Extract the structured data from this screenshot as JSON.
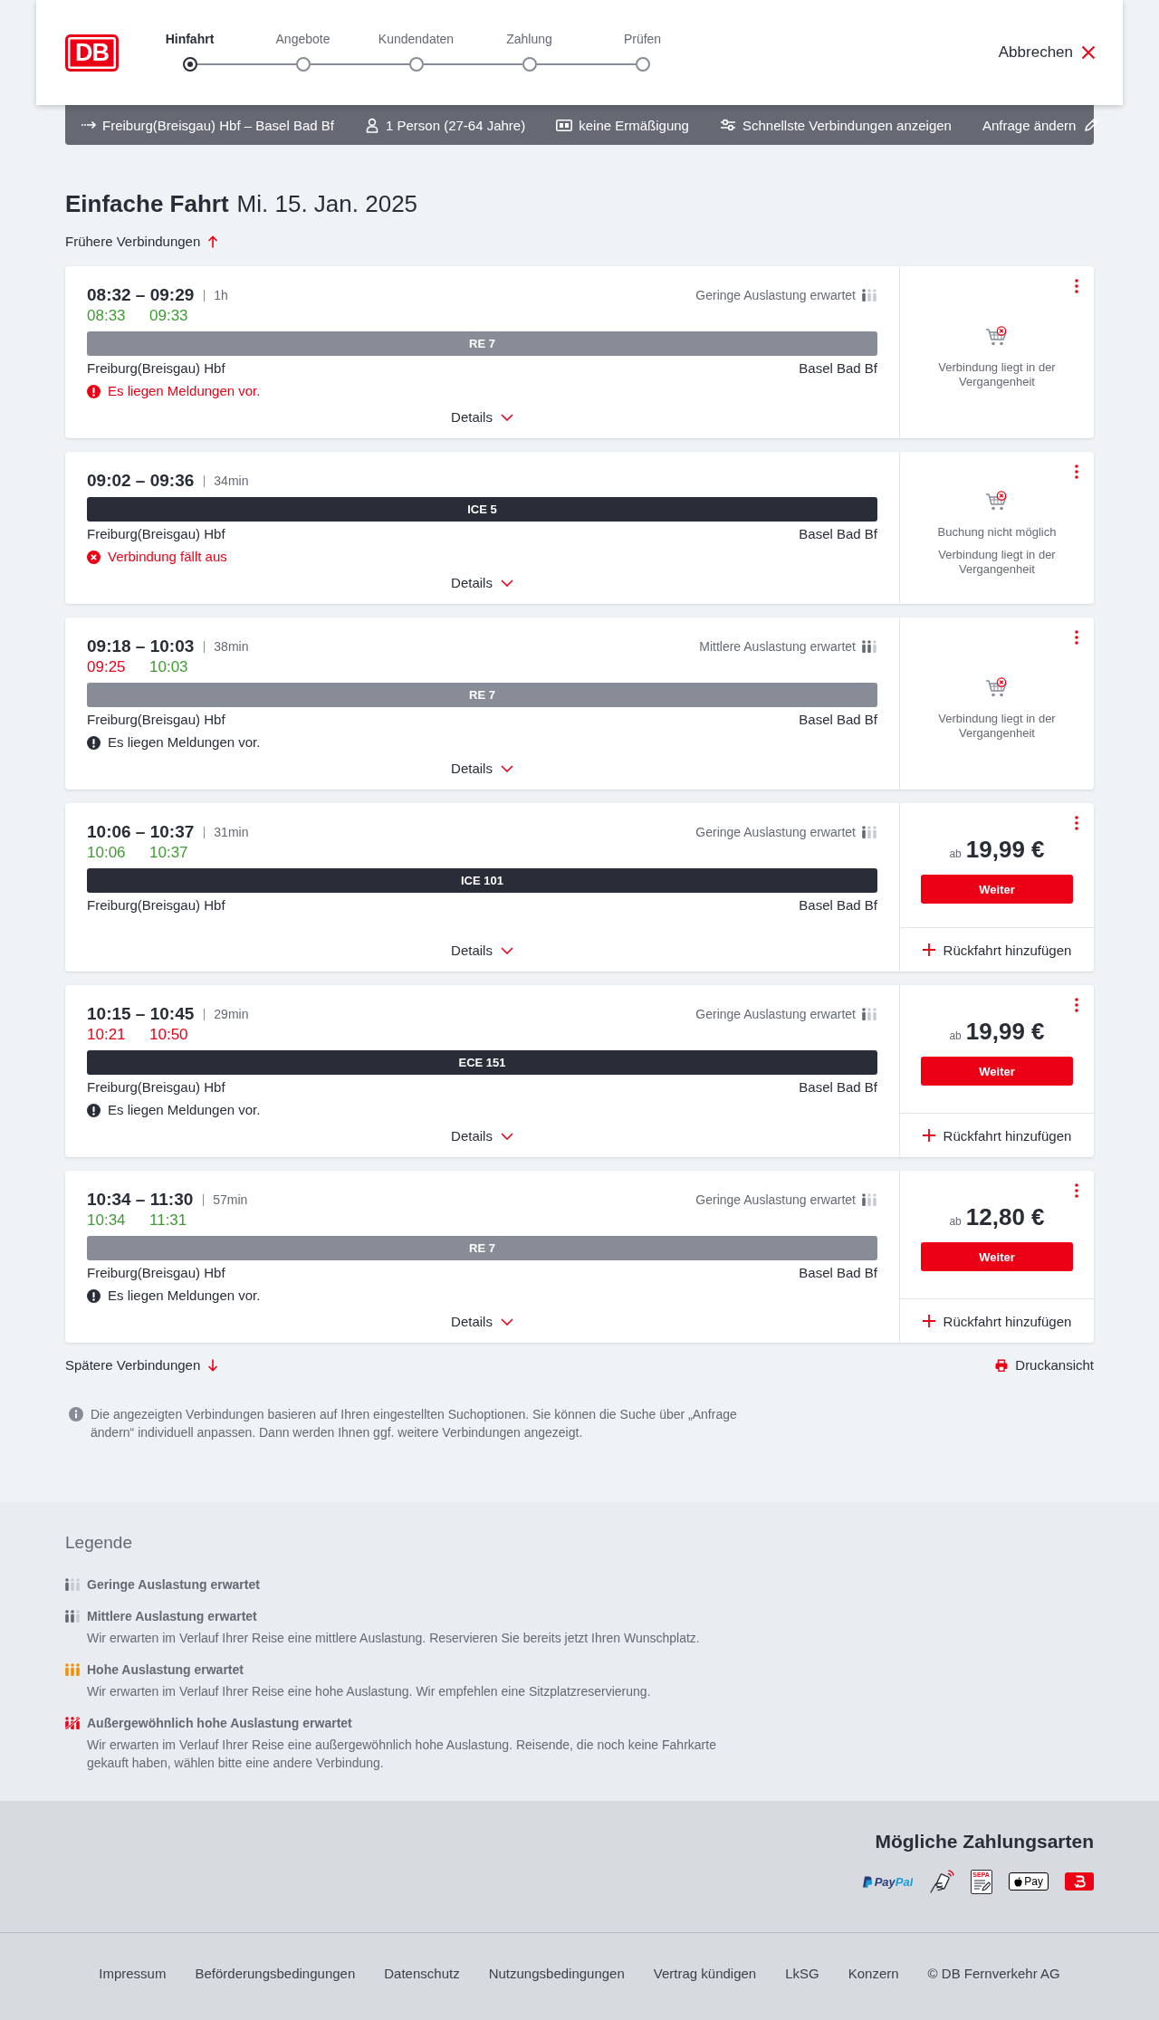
{
  "header": {
    "logo": "DB",
    "steps": [
      {
        "label": "Hinfahrt",
        "selected": true
      },
      {
        "label": "Angebote",
        "selected": false
      },
      {
        "label": "Kundendaten",
        "selected": false
      },
      {
        "label": "Zahlung",
        "selected": false
      },
      {
        "label": "Prüfen",
        "selected": false
      }
    ],
    "cancel": "Abbrechen"
  },
  "search_summary": {
    "route": "Freiburg(Breisgau) Hbf – Basel Bad Bf",
    "passengers": "1 Person (27-64 Jahre)",
    "discount": "keine Ermäßigung",
    "option": "Schnellste Verbindungen anzeigen",
    "edit": "Anfrage ändern"
  },
  "heading": {
    "trip_type": "Einfache Fahrt",
    "date": "Mi. 15. Jan. 2025"
  },
  "earlier": "Frühere Verbindungen",
  "connections": [
    {
      "times": "08:32 – 09:29",
      "duration": "1h",
      "realtime": [
        {
          "time": "08:33",
          "delayed": false
        },
        {
          "time": "09:33",
          "delayed": false
        }
      ],
      "occupancy": {
        "kind": "low",
        "text": "Geringe Auslastung erwartet"
      },
      "train": {
        "name": "RE 7",
        "kind": "regional"
      },
      "from": "Freiburg(Breisgau) Hbf",
      "to": "Basel Bad Bf",
      "message": {
        "kind": "notice",
        "urgent": true,
        "text": "Es liegen Meldungen vor."
      },
      "details": "Details",
      "offer": {
        "kind": "unavailable",
        "notes": [
          "Verbindung liegt in der Vergangenheit"
        ]
      }
    },
    {
      "times": "09:02 – 09:36",
      "duration": "34min",
      "train": {
        "name": "ICE 5",
        "kind": "long_distance"
      },
      "from": "Freiburg(Breisgau) Hbf",
      "to": "Basel Bad Bf",
      "message": {
        "kind": "cancelled",
        "urgent": true,
        "text": "Verbindung fällt aus"
      },
      "details": "Details",
      "offer": {
        "kind": "unavailable",
        "notes": [
          "Buchung nicht möglich",
          "Verbindung liegt in der Vergangenheit"
        ]
      }
    },
    {
      "times": "09:18 – 10:03",
      "duration": "38min",
      "realtime": [
        {
          "time": "09:25",
          "delayed": true
        },
        {
          "time": "10:03",
          "delayed": false
        }
      ],
      "occupancy": {
        "kind": "medium",
        "text": "Mittlere Auslastung erwartet"
      },
      "train": {
        "name": "RE 7",
        "kind": "regional"
      },
      "from": "Freiburg(Breisgau) Hbf",
      "to": "Basel Bad Bf",
      "message": {
        "kind": "notice",
        "urgent": false,
        "text": "Es liegen Meldungen vor."
      },
      "details": "Details",
      "offer": {
        "kind": "unavailable",
        "notes": [
          "Verbindung liegt in der Vergangenheit"
        ]
      }
    },
    {
      "times": "10:06 – 10:37",
      "duration": "31min",
      "realtime": [
        {
          "time": "10:06",
          "delayed": false
        },
        {
          "time": "10:37",
          "delayed": false
        }
      ],
      "occupancy": {
        "kind": "low",
        "text": "Geringe Auslastung erwartet"
      },
      "train": {
        "name": "ICE 101",
        "kind": "long_distance"
      },
      "from": "Freiburg(Breisgau) Hbf",
      "to": "Basel Bad Bf",
      "details": "Details",
      "offer": {
        "kind": "price",
        "prefix": "ab",
        "price": "19,99 €",
        "button": "Weiter",
        "return_trip": "Rückfahrt hinzufügen"
      }
    },
    {
      "times": "10:15 – 10:45",
      "duration": "29min",
      "realtime": [
        {
          "time": "10:21",
          "delayed": true
        },
        {
          "time": "10:50",
          "delayed": true
        }
      ],
      "occupancy": {
        "kind": "low",
        "text": "Geringe Auslastung erwartet"
      },
      "train": {
        "name": "ECE 151",
        "kind": "long_distance"
      },
      "from": "Freiburg(Breisgau) Hbf",
      "to": "Basel Bad Bf",
      "message": {
        "kind": "notice",
        "urgent": false,
        "text": "Es liegen Meldungen vor."
      },
      "details": "Details",
      "offer": {
        "kind": "price",
        "prefix": "ab",
        "price": "19,99 €",
        "button": "Weiter",
        "return_trip": "Rückfahrt hinzufügen"
      }
    },
    {
      "times": "10:34 – 11:30",
      "duration": "57min",
      "realtime": [
        {
          "time": "10:34",
          "delayed": false
        },
        {
          "time": "11:31",
          "delayed": false
        }
      ],
      "occupancy": {
        "kind": "low",
        "text": "Geringe Auslastung erwartet"
      },
      "train": {
        "name": "RE 7",
        "kind": "regional"
      },
      "from": "Freiburg(Breisgau) Hbf",
      "to": "Basel Bad Bf",
      "message": {
        "kind": "notice",
        "urgent": false,
        "text": "Es liegen Meldungen vor."
      },
      "details": "Details",
      "offer": {
        "kind": "price",
        "prefix": "ab",
        "price": "12,80 €",
        "button": "Weiter",
        "return_trip": "Rückfahrt hinzufügen"
      }
    }
  ],
  "later": "Spätere Verbindungen",
  "print": "Druckansicht",
  "note": "Die angezeigten Verbindungen basieren auf Ihren eingestellten Suchoptionen. Sie können die Suche über „Anfrage ändern“ individuell anpassen. Dann werden Ihnen ggf. weitere Verbindungen angezeigt.",
  "legend": {
    "title": "Legende",
    "items": [
      {
        "kind": "low",
        "title": "Geringe Auslastung erwartet"
      },
      {
        "kind": "medium",
        "title": "Mittlere Auslastung erwartet",
        "text": "Wir erwarten im Verlauf Ihrer Reise eine mittlere Auslastung. Reservieren Sie bereits jetzt Ihren Wunschplatz."
      },
      {
        "kind": "high",
        "title": "Hohe Auslastung erwartet",
        "text": "Wir erwarten im Verlauf Ihrer Reise eine hohe Auslastung. Wir empfehlen eine Sitzplatzreservierung."
      },
      {
        "kind": "exceptional",
        "title": "Außergewöhnlich hohe Auslastung erwartet",
        "text": "Wir erwarten im Verlauf Ihrer Reise eine außergewöhnlich hohe Auslastung. Reisende, die noch keine Fahrkarte gekauft haben, wählen bitte eine andere Verbindung."
      }
    ]
  },
  "payment": {
    "title": "Mögliche Zahlungsarten",
    "methods": [
      {
        "kind": "paypal",
        "label": "PayPal"
      },
      {
        "kind": "card"
      },
      {
        "kind": "sepa",
        "label": "SEPA"
      },
      {
        "kind": "applepay",
        "label": "Pay"
      },
      {
        "kind": "bonus"
      }
    ]
  },
  "footer_links": [
    "Impressum",
    "Beförderungsbedingungen",
    "Datenschutz",
    "Nutzungsbedingungen",
    "Vertrag kündigen",
    "LkSG",
    "Konzern",
    "© DB Fernverkehr AG"
  ]
}
